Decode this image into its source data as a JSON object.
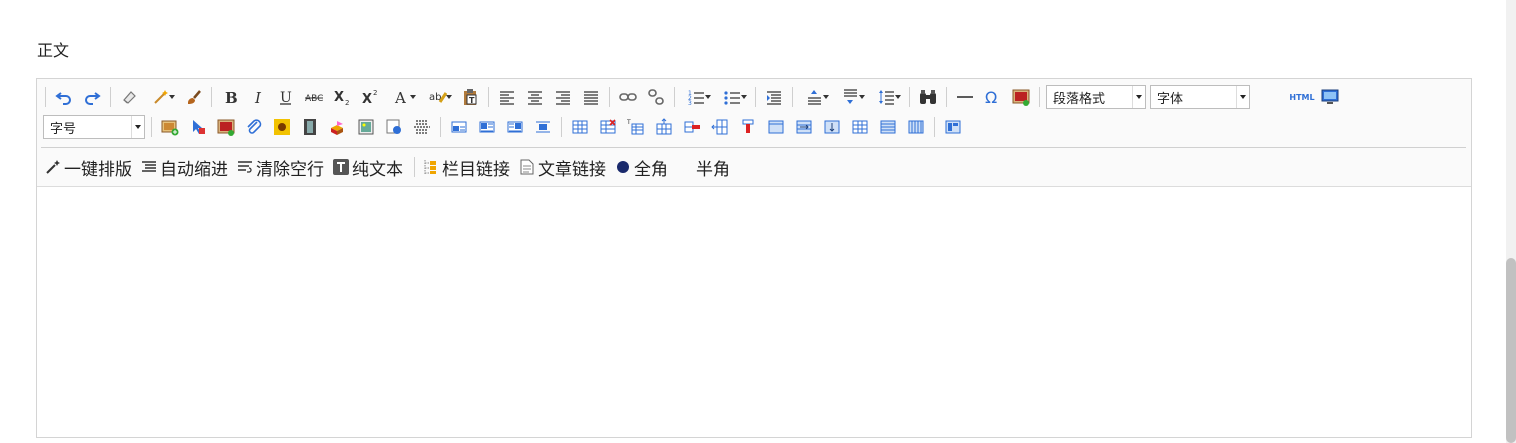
{
  "field_label": "正文",
  "toolbar": {
    "paragraph_format_select": "段落格式",
    "font_family_select": "字体",
    "font_size_select": "字号",
    "html_label": "HTML"
  },
  "quick_bar": {
    "items": [
      {
        "label": "一键排版",
        "icon": "magic-wand-icon"
      },
      {
        "label": "自动缩进",
        "icon": "indent-icon"
      },
      {
        "label": "清除空行",
        "icon": "clear-lines-icon"
      },
      {
        "label": "纯文本",
        "icon": "plain-text-icon"
      },
      {
        "label": "栏目链接",
        "icon": "column-link-icon"
      },
      {
        "label": "文章链接",
        "icon": "article-link-icon"
      },
      {
        "label": "全角",
        "icon": "full-width-icon"
      },
      {
        "label": "半角",
        "icon": "half-width-icon"
      }
    ]
  },
  "colors": {
    "accent_blue": "#2f6fd6",
    "toolbar_bg": "#fafafa",
    "border": "#d4d4d4"
  }
}
